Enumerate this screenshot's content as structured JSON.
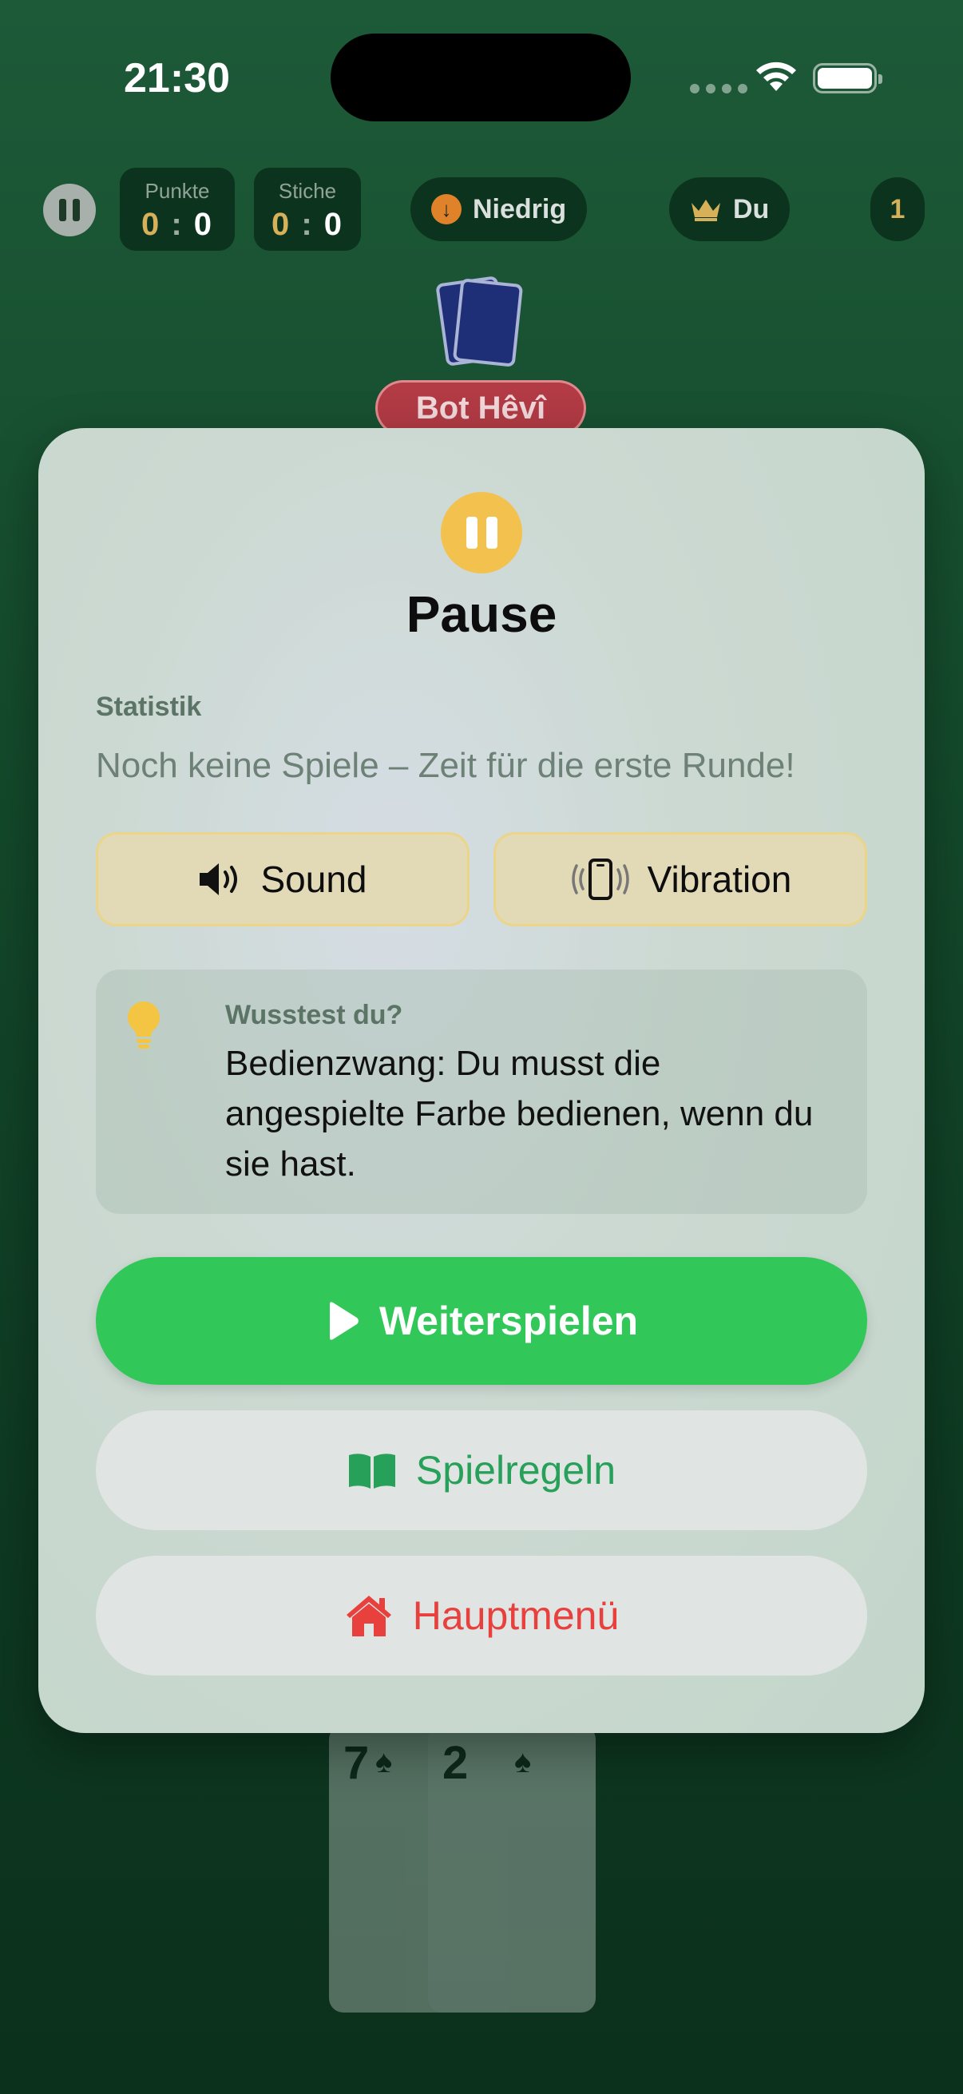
{
  "status_bar": {
    "time": "21:30"
  },
  "hud": {
    "points": {
      "label": "Punkte",
      "left": "0",
      "sep": ":",
      "right": "0"
    },
    "tricks": {
      "label": "Stiche",
      "left": "0",
      "sep": ":",
      "right": "0"
    },
    "mode": "Niedrig",
    "leader": "Du",
    "round": "1"
  },
  "opponent": {
    "name": "Bot Hêvî"
  },
  "hand": [
    {
      "rank": "7",
      "suit": "♠"
    },
    {
      "rank": "2",
      "suit": "♠"
    }
  ],
  "modal": {
    "title": "Pause",
    "stats_label": "Statistik",
    "stats_text": "Noch keine Spiele – Zeit für die erste Runde!",
    "sound_label": "Sound",
    "vibration_label": "Vibration",
    "tip_heading": "Wusstest du?",
    "tip_body": "Bedienzwang: Du musst die angespielte Farbe bedienen, wenn du sie hast.",
    "continue_label": "Weiterspielen",
    "rules_label": "Spielregeln",
    "menu_label": "Hauptmenü"
  },
  "colors": {
    "accent_green": "#32c859",
    "accent_yellow": "#f2c14e",
    "danger_red": "#e8403d",
    "rules_green": "#27a05a"
  }
}
